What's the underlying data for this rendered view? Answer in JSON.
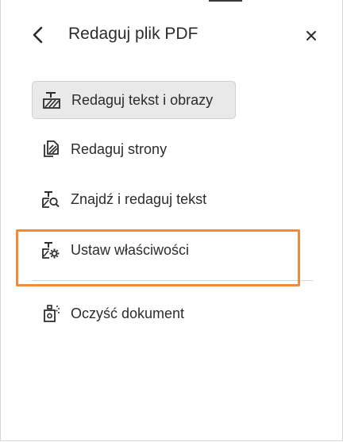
{
  "header": {
    "title": "Redaguj plik PDF",
    "back_icon": "chevron-left-icon",
    "close_icon": "close-icon"
  },
  "menu": {
    "items": [
      {
        "label": "Redaguj tekst i obrazy",
        "icon": "redact-text-image-icon",
        "selected": true
      },
      {
        "label": "Redaguj strony",
        "icon": "redact-pages-icon",
        "selected": false
      },
      {
        "label": "Znajdź i redaguj tekst",
        "icon": "find-redact-icon",
        "selected": false
      },
      {
        "label": "Ustaw właściwości",
        "icon": "redaction-properties-icon",
        "selected": false
      },
      {
        "label": "Oczyść dokument",
        "icon": "sanitize-document-icon",
        "selected": false
      }
    ]
  },
  "colors": {
    "highlight": "#f08a3c",
    "selected_bg": "#e9e9e9",
    "text": "#2c2c2c"
  }
}
